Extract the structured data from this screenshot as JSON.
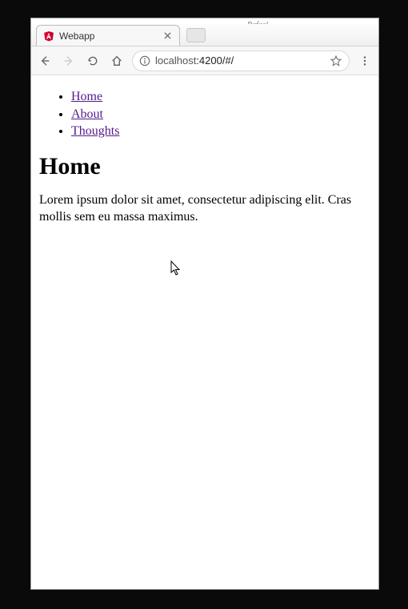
{
  "window": {
    "user_label": "Rafael"
  },
  "tab": {
    "title": "Webapp"
  },
  "address": {
    "host": "localhost",
    "port_path": ":4200/#/"
  },
  "nav": {
    "items": [
      {
        "label": "Home"
      },
      {
        "label": "About"
      },
      {
        "label": "Thoughts"
      }
    ]
  },
  "page": {
    "heading": "Home",
    "body": "Lorem ipsum dolor sit amet, consectetur adipiscing elit. Cras mollis sem eu massa maximus."
  }
}
